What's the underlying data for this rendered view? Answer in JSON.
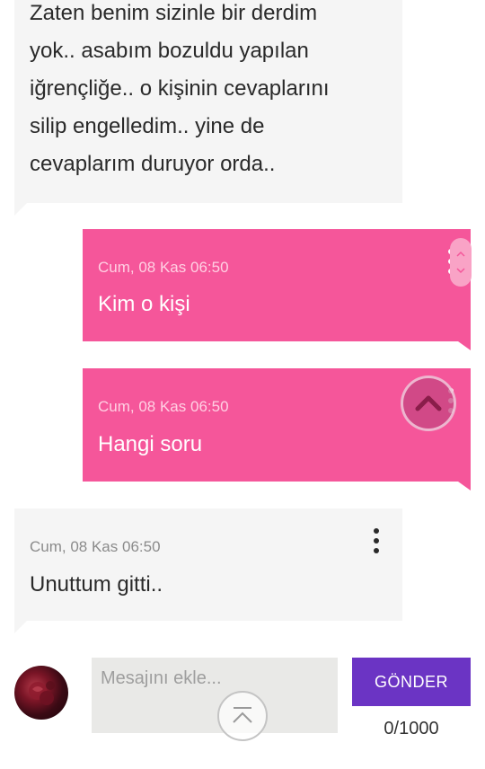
{
  "messages": [
    {
      "direction": "incoming",
      "text": "Zaten benim sizinle bir derdim yok.. asabım bozuldu yapılan iğrençliğe.. o kişinin cevaplarını silip engelledim.. yine de cevaplarım duruyor orda.."
    },
    {
      "direction": "outgoing",
      "time": "Cum, 08 Kas 06:50",
      "text": "Kim o kişi"
    },
    {
      "direction": "outgoing",
      "time": "Cum, 08 Kas 06:50",
      "text": "Hangi soru"
    },
    {
      "direction": "incoming",
      "time": "Cum, 08 Kas 06:50",
      "text": "Unuttum gitti.."
    }
  ],
  "composer": {
    "placeholder": "Mesajını ekle...",
    "send_label": "GÖNDER",
    "counter": "0/1000"
  },
  "icons": {
    "menu": "vertical-dots-icon",
    "scroll_up": "chevron-up-icon",
    "scroll_top": "chevron-up-bar-icon"
  },
  "colors": {
    "outgoing_bubble": "#f5569a",
    "incoming_bubble": "#f5f5f5",
    "send_button": "#6b34c4"
  }
}
